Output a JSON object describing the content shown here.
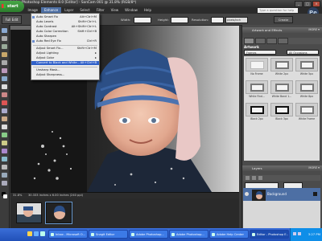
{
  "window": {
    "title": "Adobe Photoshop Elements 8.0 [Editor] - SonCam 001 @ 31.8% (RGB/8*)"
  },
  "menubar": [
    {
      "label": "File",
      "active": false
    },
    {
      "label": "Edit",
      "active": false
    },
    {
      "label": "Image",
      "active": false
    },
    {
      "label": "Enhance",
      "active": true
    },
    {
      "label": "Layer",
      "active": false
    },
    {
      "label": "Select",
      "active": false
    },
    {
      "label": "Filter",
      "active": false
    },
    {
      "label": "View",
      "active": false
    },
    {
      "label": "Window",
      "active": false
    },
    {
      "label": "Help",
      "active": false
    }
  ],
  "help_search": {
    "placeholder": "Type a question for help"
  },
  "logo": {
    "text": "Pe"
  },
  "options_bar": {
    "full_edit_label": "Full Edit",
    "width_label": "Width:",
    "height_label": "Height:",
    "resolution_label": "Resolution:",
    "resolution_unit": "pixels/inch",
    "create_label": "Create"
  },
  "enhance_menu": {
    "items": [
      {
        "label": "Auto Smart Fix",
        "shortcut": "Alt+Ctrl+M",
        "icon": true,
        "type": "item"
      },
      {
        "label": "Auto Levels",
        "shortcut": "Shift+Ctrl+L",
        "type": "item"
      },
      {
        "label": "Auto Contrast",
        "shortcut": "Alt+Shift+Ctrl+L",
        "type": "item"
      },
      {
        "label": "Auto Color Correction",
        "shortcut": "Shift+Ctrl+B",
        "type": "item"
      },
      {
        "label": "Auto Sharpen",
        "shortcut": "",
        "type": "item"
      },
      {
        "label": "Auto Red Eye Fix",
        "shortcut": "Ctrl+R",
        "icon": true,
        "type": "item"
      },
      {
        "type": "sep"
      },
      {
        "label": "Adjust Smart Fix...",
        "shortcut": "Shift+Ctrl+M",
        "type": "item"
      },
      {
        "label": "Adjust Lighting",
        "shortcut": "▸",
        "type": "item"
      },
      {
        "label": "Adjust Color",
        "shortcut": "▸",
        "type": "item"
      },
      {
        "label": "Convert to Black and White...",
        "shortcut": "Alt+Ctrl+B",
        "type": "item",
        "highlight": true
      },
      {
        "type": "sep"
      },
      {
        "label": "Unsharp Mask...",
        "shortcut": "",
        "type": "item"
      },
      {
        "label": "Adjust Sharpness...",
        "shortcut": "",
        "type": "item"
      }
    ]
  },
  "document": {
    "status_zoom": "31.8%",
    "status_info": "30.333 inches x 6.00 inches (240 ppi)"
  },
  "panels": {
    "effects_header": "Artwork and Effects",
    "effects_more": "MORE ▾",
    "artwork_title": "Artwork",
    "combo_left": "Frames",
    "combo_right": "All Occasions",
    "frame_names": [
      "No Frame",
      "White 2px",
      "White 5px",
      "White Rnd...",
      "White Band 1...",
      "White 8px",
      "Black 2px",
      "Black 3px",
      "White Frame"
    ],
    "layers_header": "Layers",
    "layers_more": "MORE ▾",
    "layer_name": "Background"
  },
  "taskbar": {
    "start_label": "start",
    "tasks": [
      {
        "label": "Inbox - Microsoft O...",
        "active": false
      },
      {
        "label": "Snagit Editor",
        "active": false
      },
      {
        "label": "Adobe Photoshop...",
        "active": false
      },
      {
        "label": "Adobe Photoshop...",
        "active": false
      },
      {
        "label": "Adobe Help Center",
        "active": false
      },
      {
        "label": "Editor - Photoshop E...",
        "active": true
      }
    ],
    "clock": "3:27 PM"
  }
}
